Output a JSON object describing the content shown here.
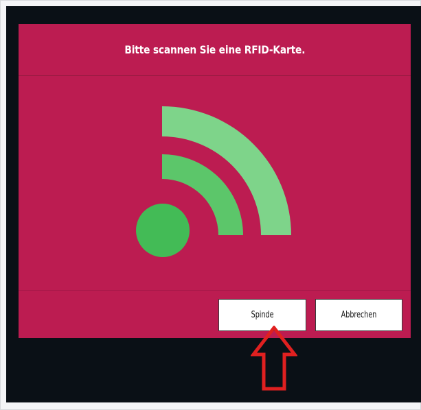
{
  "dialog": {
    "title": "Bitte scannen Sie eine RFID-Karte.",
    "icon": "rfid-signal-icon",
    "background_color": "#bc1c51"
  },
  "buttons": {
    "spinde_label": "Spinde",
    "cancel_label": "Abbrechen"
  },
  "annotation": {
    "icon": "up-arrow-annotation",
    "color": "#e02020"
  }
}
